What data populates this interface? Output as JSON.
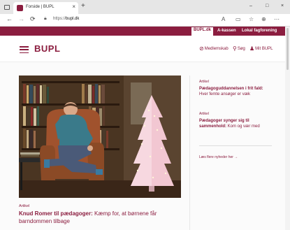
{
  "browser": {
    "tab_title": "Forside | BUPL",
    "tab_close": "×",
    "new_tab": "+",
    "url_prefix": "https://",
    "url_domain": "bupl.dk",
    "window_controls": [
      "–",
      "□",
      "×"
    ],
    "nav_icons": [
      "back-icon",
      "forward-icon",
      "refresh-icon"
    ],
    "toolbar_icons": [
      "read-aloud-icon",
      "collections-icon",
      "favorites-icon",
      "profile-icon",
      "settings-icon"
    ]
  },
  "topnav": {
    "items": [
      "BUPL.dk",
      "A-kassen",
      "Lokal fagforening"
    ]
  },
  "header": {
    "logo": "BUPL",
    "links": [
      {
        "icon": "member-icon",
        "label": "Medlemskab"
      },
      {
        "icon": "search-icon",
        "label": "Søg"
      },
      {
        "icon": "user-icon",
        "label": "Mit BUPL"
      }
    ]
  },
  "main_article": {
    "meta": "Artikel",
    "title_bold": "Knud Romer til pædagoger:",
    "title_rest": " Kæmp for, at børnene får barndommen tilbage"
  },
  "aside": {
    "items": [
      {
        "meta": "Artikel",
        "title_bold": "Pædagoguddannelsen i frit fald:",
        "title_rest": " Hver femte ansøger er væk"
      },
      {
        "meta": "Artikel",
        "title_bold": "Pædagoger synger sig til sammenhold:",
        "title_rest": " Kom og vær med"
      }
    ],
    "more_link": "Læs flere nyheder her →"
  },
  "colors": {
    "brand": "#8b1d3f"
  }
}
